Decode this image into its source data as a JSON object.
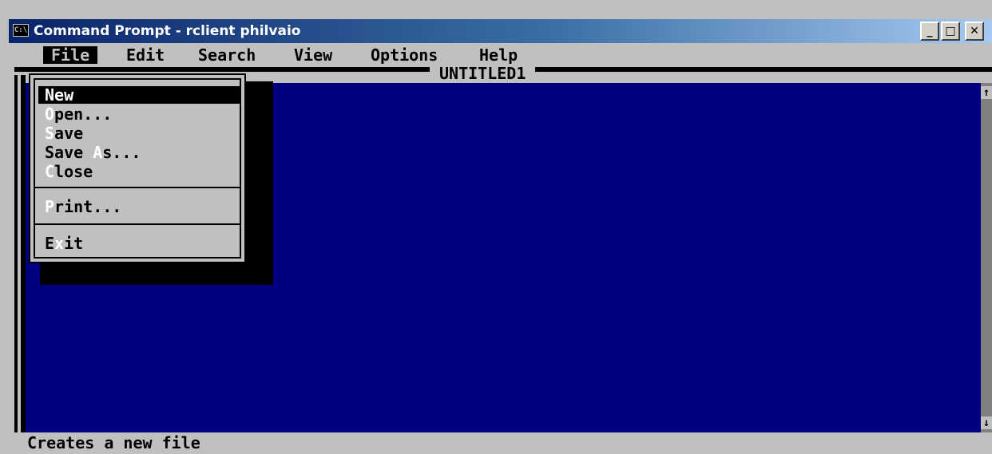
{
  "window": {
    "title": "Command Prompt - rclient philvaio",
    "icon": "C:\\",
    "controls": {
      "minimize": "_",
      "maximize": "□",
      "close": "✕"
    }
  },
  "menubar": {
    "items": [
      "File",
      "Edit",
      "Search",
      "View",
      "Options",
      "Help"
    ]
  },
  "document": {
    "title": "UNTITLED1"
  },
  "file_menu": {
    "items": [
      {
        "hotkey": "N",
        "rest": "ew",
        "prefix": ""
      },
      {
        "hotkey": "O",
        "rest": "pen...",
        "prefix": ""
      },
      {
        "hotkey": "S",
        "rest": "ave",
        "prefix": ""
      },
      {
        "hotkey": "A",
        "rest": "s...",
        "prefix": "Save "
      },
      {
        "hotkey": "C",
        "rest": "lose",
        "prefix": ""
      },
      {
        "hotkey": "P",
        "rest": "rint...",
        "prefix": ""
      },
      {
        "hotkey": "x",
        "rest": "it",
        "prefix": "E"
      }
    ]
  },
  "scrollbar": {
    "up": "↑",
    "down": "↓"
  },
  "status": {
    "text": "Creates a new file"
  },
  "colors": {
    "editor_bg": "#000080",
    "console_gray": "#c0c0c0",
    "title_start": "#0a246a",
    "title_end": "#a6caf0"
  }
}
